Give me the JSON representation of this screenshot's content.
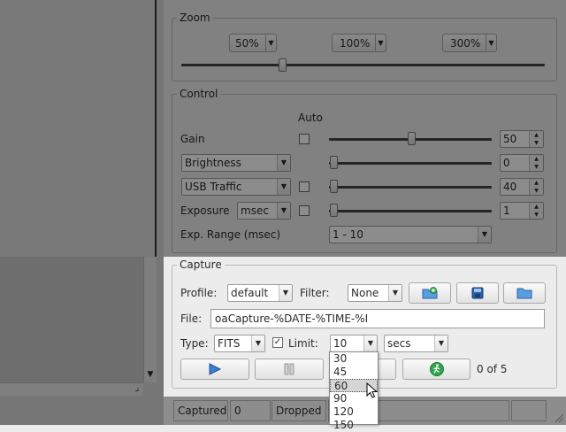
{
  "zoom": {
    "title": "Zoom",
    "options": [
      "50%",
      "100%",
      "300%"
    ]
  },
  "control": {
    "title": "Control",
    "auto_label": "Auto",
    "gain_label": "Gain",
    "gain_value": "50",
    "brightness_label": "Brightness",
    "brightness_value": "0",
    "usb_label": "USB Traffic",
    "usb_value": "40",
    "exposure_label": "Exposure",
    "exposure_unit": "msec",
    "exposure_value": "1",
    "exp_range_label": "Exp. Range (msec)",
    "exp_range_value": "1 - 10"
  },
  "capture": {
    "title": "Capture",
    "profile_label": "Profile:",
    "profile_value": "default",
    "filter_label": "Filter:",
    "filter_value": "None",
    "file_label": "File:",
    "file_value": "oaCapture-%DATE-%TIME-%I",
    "type_label": "Type:",
    "type_value": "FITS",
    "limit_label": "Limit:",
    "limit_value": "10",
    "limit_unit": "secs",
    "progress_text": "0 of 5",
    "limit_options": [
      "30",
      "45",
      "60",
      "90",
      "120",
      "150"
    ],
    "limit_selected": "60"
  },
  "status": {
    "captured_label": "Captured",
    "captured_value": "0",
    "dropped_label": "Dropped"
  },
  "colors": {
    "accent": "#3a7fd6",
    "green": "#2ea84a"
  }
}
